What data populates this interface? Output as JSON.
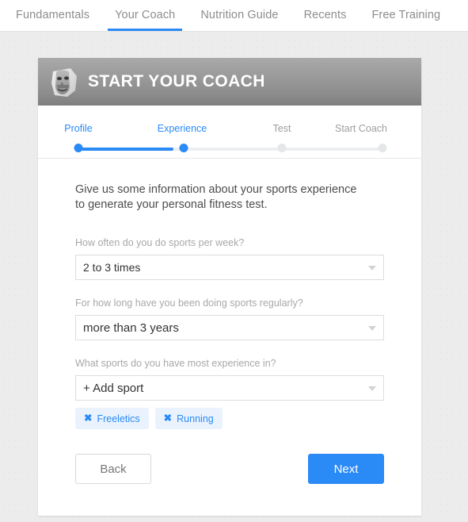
{
  "nav": {
    "tabs": [
      {
        "label": "Fundamentals",
        "active": false
      },
      {
        "label": "Your Coach",
        "active": true
      },
      {
        "label": "Nutrition Guide",
        "active": false
      },
      {
        "label": "Recents",
        "active": false
      },
      {
        "label": "Free Training",
        "active": false
      }
    ]
  },
  "card": {
    "title": "START YOUR COACH",
    "avatar_alt": "coach-avatar-photo",
    "accent_color": "#2a8af6",
    "header_gradient_from": "#a9a9a9",
    "header_gradient_to": "#7f7f7f"
  },
  "stepper": {
    "steps": [
      {
        "label": "Profile",
        "state": "done"
      },
      {
        "label": "Experience",
        "state": "current"
      },
      {
        "label": "Test",
        "state": "todo"
      },
      {
        "label": "Start Coach",
        "state": "todo"
      }
    ],
    "progress_percent": 31.5
  },
  "main": {
    "intro": "Give us some information about your sports experience to generate your personal fitness test.",
    "fields": [
      {
        "label": "How often do you do sports per week?",
        "value": "2 to 3 times",
        "placeholder": "2 to 3 times"
      },
      {
        "label": "For how long have you been doing sports regularly?",
        "value": "more than 3 years",
        "placeholder": "more than 3 years"
      },
      {
        "label": "What sports do you have most experience in?",
        "value": "+ Add sport",
        "placeholder": "+ Add sport"
      }
    ],
    "chips": [
      {
        "label": "Freeletics",
        "remove": "✖"
      },
      {
        "label": "Running",
        "remove": "✖"
      }
    ]
  },
  "actions": {
    "back_label": "Back",
    "next_label": "Next"
  }
}
